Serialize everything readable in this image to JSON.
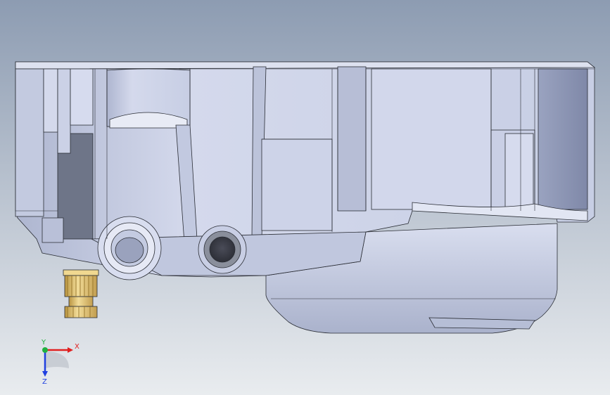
{
  "viewport": {
    "background_top": "#8d9cb2",
    "background_bottom": "#e9ecef",
    "model_fill": "#c9d0e6",
    "model_fill_light": "#dfe3f2",
    "model_shadow": "#9aa3bf",
    "edge_color": "#2a2d35",
    "insert_color": "#e8c97a"
  },
  "triad": {
    "x_label": "X",
    "y_label": "Y",
    "z_label": "Z",
    "x_color": "#e02020",
    "y_color": "#20b040",
    "z_color": "#2040e0"
  }
}
